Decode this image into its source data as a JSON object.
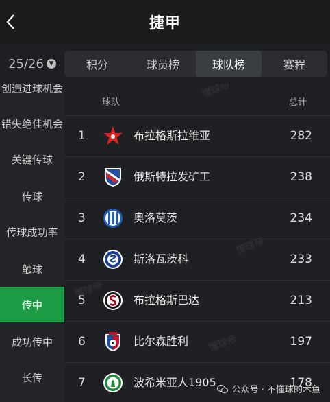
{
  "header": {
    "title": "捷甲"
  },
  "season": {
    "label": "25/26"
  },
  "tabs": [
    {
      "label": "积分"
    },
    {
      "label": "球员榜"
    },
    {
      "label": "球队榜",
      "active": true
    },
    {
      "label": "赛程"
    }
  ],
  "sidebar": {
    "items": [
      {
        "label": "创造进球机会"
      },
      {
        "label": "错失绝佳机会"
      },
      {
        "label": "关键传球"
      },
      {
        "label": "传球"
      },
      {
        "label": "传球成功率"
      },
      {
        "label": "触球"
      },
      {
        "label": "传中",
        "active": true
      },
      {
        "label": "成功传中"
      },
      {
        "label": "长传"
      }
    ]
  },
  "table": {
    "col_team": "球队",
    "col_total": "总计",
    "rows": [
      {
        "rank": "1",
        "team": "布拉格斯拉维亚",
        "total": "282",
        "logo": "slavia-star-icon"
      },
      {
        "rank": "2",
        "team": "俄斯特拉发矿工",
        "total": "238",
        "logo": "banik-crest-icon"
      },
      {
        "rank": "3",
        "team": "奥洛莫茨",
        "total": "234",
        "logo": "olomouc-crest-icon"
      },
      {
        "rank": "4",
        "team": "斯洛瓦茨科",
        "total": "233",
        "logo": "slovacko-crest-icon"
      },
      {
        "rank": "5",
        "team": "布拉格斯巴达",
        "total": "213",
        "logo": "sparta-crest-icon"
      },
      {
        "rank": "6",
        "team": "比尔森胜利",
        "total": "197",
        "logo": "plzen-crest-icon"
      },
      {
        "rank": "7",
        "team": "波希米亚人1905",
        "total": "178",
        "logo": "bohemians-crest-icon"
      }
    ]
  },
  "footer": {
    "credit": "公众号 · 不懂球的木鱼"
  },
  "watermark": {
    "text": "懂球帝"
  },
  "colors": {
    "accent": "#1e9c45",
    "background": "#1e1f22"
  }
}
